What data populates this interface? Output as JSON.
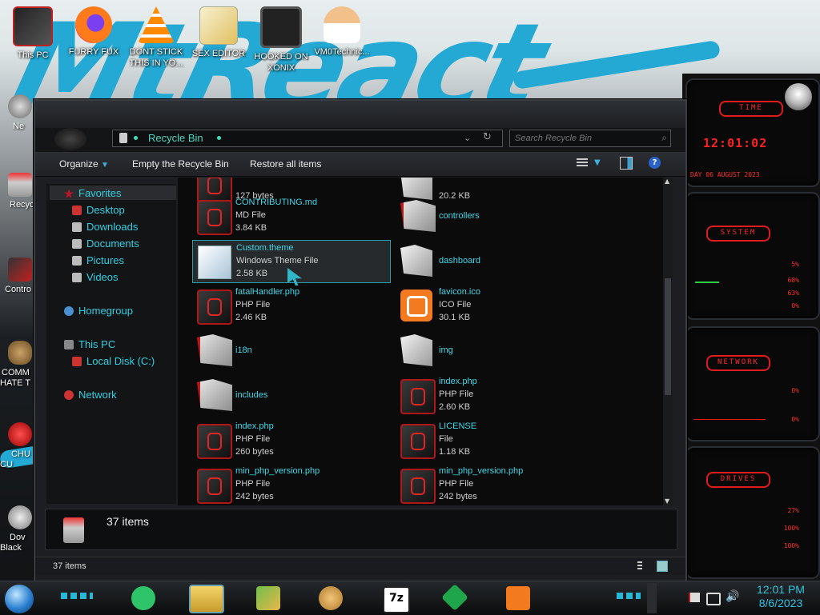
{
  "desktop": {
    "icons": [
      {
        "label": "This PC"
      },
      {
        "label": "FURRY FUX"
      },
      {
        "label": "DONT STICK THIS IN YO..."
      },
      {
        "label": "SEX EDITOR"
      },
      {
        "label": "HOOKED ON XONIX"
      },
      {
        "label": "VM0Technic..."
      }
    ],
    "left_icons": [
      {
        "label": "Ne"
      },
      {
        "label": "Recyc"
      },
      {
        "label": "Contro"
      },
      {
        "label": "COMM HATE T"
      },
      {
        "label": "CHU CU"
      },
      {
        "label": "Dov Black"
      }
    ]
  },
  "widgets": {
    "time": {
      "title": "TIME",
      "clock": "12:01:02",
      "date": "DAY 06 AUGUST 2023"
    },
    "system": {
      "title": "SYSTEM",
      "values": [
        "5%",
        "68%",
        "63%",
        "0%"
      ]
    },
    "network": {
      "title": "NETWORK",
      "values": [
        "0%",
        "0%"
      ]
    },
    "drives": {
      "title": "DRIVES",
      "values": [
        "27%",
        "100%",
        "100%"
      ]
    }
  },
  "explorer": {
    "address": "Recycle Bin",
    "search_placeholder": "Search Recycle Bin",
    "toolbar": {
      "organize": "Organize",
      "empty": "Empty the Recycle Bin",
      "restore": "Restore all items"
    },
    "nav": {
      "favorites": "Favorites",
      "desktop": "Desktop",
      "downloads": "Downloads",
      "documents": "Documents",
      "pictures": "Pictures",
      "videos": "Videos",
      "homegroup": "Homegroup",
      "thispc": "This PC",
      "localdisk": "Local Disk (C:)",
      "network": "Network"
    },
    "files": [
      {
        "name": "",
        "type": "",
        "size": "127 bytes"
      },
      {
        "name": "",
        "type": "",
        "size": "20.2 KB"
      },
      {
        "name": "CONTRIBUTING.md",
        "type": "MD File",
        "size": "3.84 KB"
      },
      {
        "name": "controllers",
        "type": "",
        "size": ""
      },
      {
        "name": "Custom.theme",
        "type": "Windows Theme File",
        "size": "2.58 KB"
      },
      {
        "name": "dashboard",
        "type": "",
        "size": ""
      },
      {
        "name": "fatalHandler.php",
        "type": "PHP File",
        "size": "2.46 KB"
      },
      {
        "name": "favicon.ico",
        "type": "ICO File",
        "size": "30.1 KB"
      },
      {
        "name": "i18n",
        "type": "",
        "size": ""
      },
      {
        "name": "img",
        "type": "",
        "size": ""
      },
      {
        "name": "includes",
        "type": "",
        "size": ""
      },
      {
        "name": "index.php",
        "type": "PHP File",
        "size": "2.60 KB"
      },
      {
        "name": "index.php",
        "type": "PHP File",
        "size": "260 bytes"
      },
      {
        "name": "LICENSE",
        "type": "File",
        "size": "1.18 KB"
      },
      {
        "name": "min_php_version.php",
        "type": "PHP File",
        "size": "242 bytes"
      },
      {
        "name": "min_php_version.php",
        "type": "PHP File",
        "size": "242 bytes"
      }
    ],
    "details_count": "37 items",
    "status_count": "37 items"
  },
  "taskbar": {
    "time": "12:01 PM",
    "date": "8/6/2023",
    "apps": [
      "notes-app",
      "file-explorer",
      "arrow-app",
      "handshake-app",
      "7zip-app",
      "diamond-app",
      "xampp-app"
    ]
  },
  "colors": {
    "accent": "#3fd7e6",
    "widget_red": "#ff2a2a",
    "wall_blue": "#23a9d4"
  }
}
